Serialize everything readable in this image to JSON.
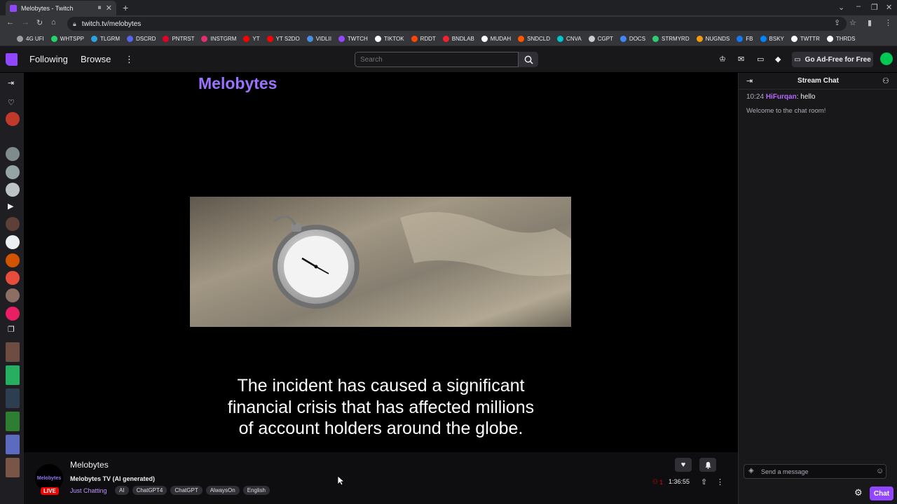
{
  "browser": {
    "tab_title": "Melobytes - Twitch",
    "url": "twitch.tv/melobytes",
    "bookmarks": [
      {
        "label": "4G UFI",
        "color": "#9aa0a6"
      },
      {
        "label": "WHTSPP",
        "color": "#25d366"
      },
      {
        "label": "TLGRM",
        "color": "#2aa3df"
      },
      {
        "label": "DSCRD",
        "color": "#5865f2"
      },
      {
        "label": "PNTRST",
        "color": "#e60023"
      },
      {
        "label": "INSTGRM",
        "color": "#e1306c"
      },
      {
        "label": "YT",
        "color": "#ff0000"
      },
      {
        "label": "YT S2DO",
        "color": "#ff0000"
      },
      {
        "label": "VIDLII",
        "color": "#4a90e2"
      },
      {
        "label": "TWTCH",
        "color": "#9146ff"
      },
      {
        "label": "TIKTOK",
        "color": "#ffffff"
      },
      {
        "label": "RDDT",
        "color": "#ff4500"
      },
      {
        "label": "BNDLAB",
        "color": "#f5222d"
      },
      {
        "label": "MUDAH",
        "color": "#ffffff"
      },
      {
        "label": "SNDCLD",
        "color": "#ff5500"
      },
      {
        "label": "CNVA",
        "color": "#00c4cc"
      },
      {
        "label": "CGPT",
        "color": "#cccccc"
      },
      {
        "label": "DOCS",
        "color": "#4285f4"
      },
      {
        "label": "STRMYRD",
        "color": "#2ecc71"
      },
      {
        "label": "NUGNDS",
        "color": "#f39c12"
      },
      {
        "label": "FB",
        "color": "#1877f2"
      },
      {
        "label": "BSKY",
        "color": "#0085ff"
      },
      {
        "label": "TWTTR",
        "color": "#ffffff"
      },
      {
        "label": "THRDS",
        "color": "#ffffff"
      }
    ]
  },
  "nav": {
    "following": "Following",
    "browse": "Browse",
    "search_placeholder": "Search",
    "ad_free": "Go Ad-Free for Free"
  },
  "player": {
    "title": "Melobytes",
    "caption_lines": [
      "The incident has caused a significant",
      "financial crisis that has affected millions",
      "of account holders around the globe."
    ]
  },
  "channel": {
    "name": "Melobytes",
    "avatar_text": "Melobytes",
    "live_badge": "LIVE",
    "stream_title": "Melobytes TV (AI generated)",
    "category": "Just Chatting",
    "tags": [
      "AI",
      "ChatGPT4",
      "ChatGPT",
      "AlwaysOn",
      "English"
    ],
    "viewers": "1",
    "uptime": "1:36:55"
  },
  "chat": {
    "title": "Stream Chat",
    "messages": [
      {
        "time": "10:24",
        "user": "HiFurqan",
        "text": "hello",
        "user_color": "#b569ff"
      }
    ],
    "welcome": "Welcome to the chat room!",
    "input_placeholder": "Send a message",
    "chat_button": "Chat"
  },
  "colors": {
    "twitch_purple": "#9146ff",
    "live_red": "#eb0400"
  }
}
